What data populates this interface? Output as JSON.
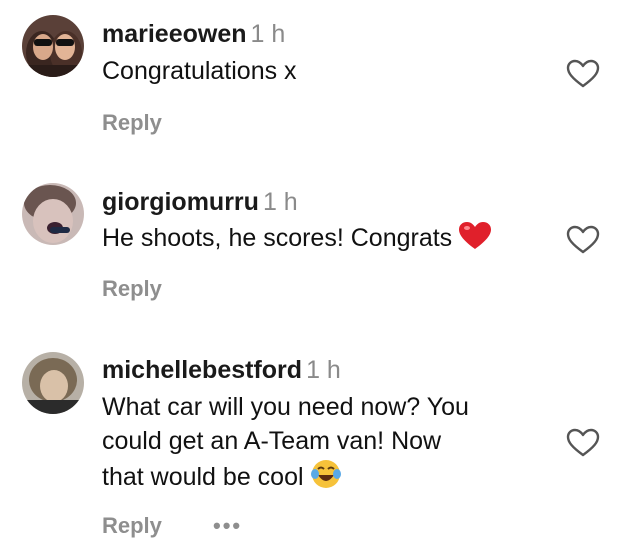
{
  "comments": [
    {
      "username": "marieeowen",
      "time": "1 h",
      "text": "Congratulations x",
      "reply_label": "Reply"
    },
    {
      "username": "giorgiomurru",
      "time": "1 h",
      "text": "He shoots, he scores! Congrats",
      "reply_label": "Reply"
    },
    {
      "username": "michellebestford",
      "time": "1 h",
      "text_lines": [
        "What car will you need now? You",
        "could get an A-Team van! Now",
        "that would be cool"
      ],
      "reply_label": "Reply",
      "more_label": "•••"
    }
  ],
  "icons": {
    "like": "heart-outline-icon",
    "red_heart": "red-heart-emoji",
    "laughing": "tears-of-joy-emoji"
  },
  "colors": {
    "text": "#111111",
    "muted": "#8e8e8e",
    "heart_emoji": "#e0202b"
  }
}
